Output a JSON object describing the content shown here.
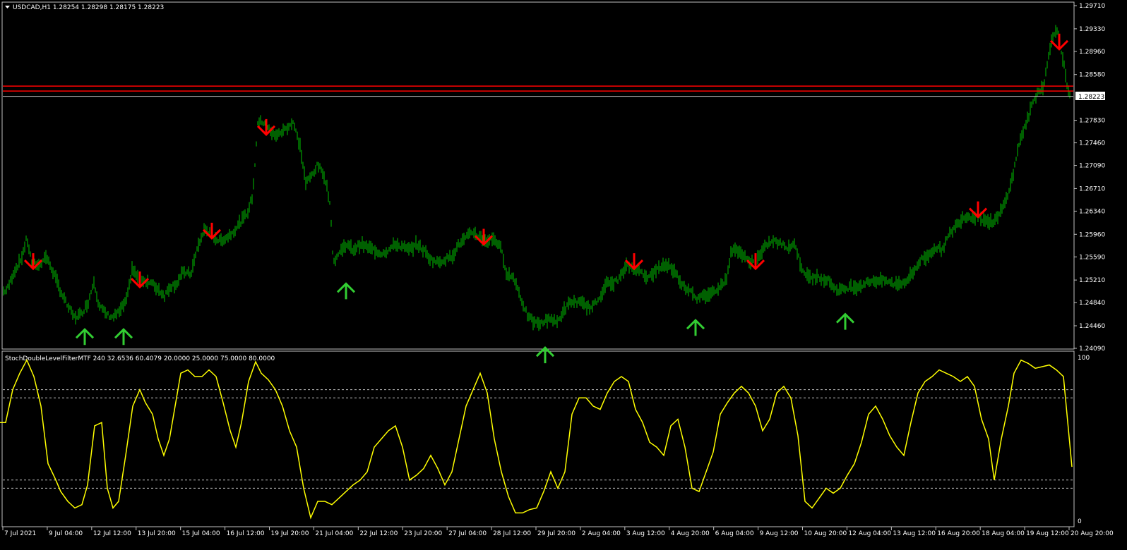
{
  "header": {
    "symbol_line": "USDCAD,H1  1.28254 1.28298 1.28175 1.28223"
  },
  "indicator": {
    "title_line": "StochDoubleLevelFilterMTF 240 32.6536 60.4079 20.0000 25.0000 75.0000 80.0000",
    "levels": [
      20,
      25,
      75,
      80
    ],
    "axis_labels": [
      "100",
      "0"
    ],
    "line_color": "#ffff00"
  },
  "price_axis": {
    "labels": [
      "1.29710",
      "1.29330",
      "1.28960",
      "1.28580",
      "1.28223",
      "1.27830",
      "1.27460",
      "1.27090",
      "1.26710",
      "1.26340",
      "1.25960",
      "1.25590",
      "1.25210",
      "1.24840",
      "1.24460",
      "1.24090"
    ],
    "current_price": "1.28223"
  },
  "time_axis": {
    "labels": [
      "7 Jul 2021",
      "9 Jul 04:00",
      "12 Jul 12:00",
      "13 Jul 20:00",
      "15 Jul 04:00",
      "16 Jul 12:00",
      "19 Jul 20:00",
      "21 Jul 04:00",
      "22 Jul 12:00",
      "23 Jul 20:00",
      "27 Jul 04:00",
      "28 Jul 12:00",
      "29 Jul 20:00",
      "2 Aug 04:00",
      "3 Aug 12:00",
      "4 Aug 20:00",
      "6 Aug 04:00",
      "9 Aug 12:00",
      "10 Aug 20:00",
      "12 Aug 04:00",
      "13 Aug 12:00",
      "16 Aug 20:00",
      "18 Aug 04:00",
      "19 Aug 12:00",
      "20 Aug 20:00"
    ]
  },
  "colors": {
    "bars": "#00c000",
    "up_arrow": "#32cd32",
    "down_arrow": "#ff0000",
    "hline": "#ff0000",
    "frame": "#c0c0c0"
  },
  "chart_data": {
    "type": "line",
    "price_path": [
      [
        0,
        1.25
      ],
      [
        10,
        1.2505
      ],
      [
        20,
        1.2535
      ],
      [
        30,
        1.2555
      ],
      [
        38,
        1.259
      ],
      [
        45,
        1.255
      ],
      [
        55,
        1.2545
      ],
      [
        65,
        1.256
      ],
      [
        75,
        1.2535
      ],
      [
        85,
        1.2505
      ],
      [
        95,
        1.248
      ],
      [
        105,
        1.246
      ],
      [
        115,
        1.2465
      ],
      [
        125,
        1.2485
      ],
      [
        133,
        1.252
      ],
      [
        140,
        1.248
      ],
      [
        150,
        1.2465
      ],
      [
        160,
        1.246
      ],
      [
        170,
        1.247
      ],
      [
        180,
        1.249
      ],
      [
        187,
        1.254
      ],
      [
        195,
        1.2525
      ],
      [
        205,
        1.252
      ],
      [
        215,
        1.2515
      ],
      [
        225,
        1.2505
      ],
      [
        233,
        1.2495
      ],
      [
        240,
        1.251
      ],
      [
        250,
        1.2515
      ],
      [
        260,
        1.2535
      ],
      [
        270,
        1.253
      ],
      [
        280,
        1.2575
      ],
      [
        290,
        1.2605
      ],
      [
        300,
        1.2595
      ],
      [
        310,
        1.2585
      ],
      [
        320,
        1.259
      ],
      [
        330,
        1.26
      ],
      [
        340,
        1.2615
      ],
      [
        350,
        1.263
      ],
      [
        358,
        1.266
      ],
      [
        365,
        1.278
      ],
      [
        375,
        1.278
      ],
      [
        385,
        1.276
      ],
      [
        395,
        1.276
      ],
      [
        405,
        1.277
      ],
      [
        415,
        1.278
      ],
      [
        425,
        1.274
      ],
      [
        433,
        1.268
      ],
      [
        440,
        1.269
      ],
      [
        450,
        1.271
      ],
      [
        460,
        1.269
      ],
      [
        467,
        1.265
      ],
      [
        472,
        1.255
      ],
      [
        480,
        1.2565
      ],
      [
        490,
        1.258
      ],
      [
        500,
        1.257
      ],
      [
        510,
        1.258
      ],
      [
        520,
        1.2575
      ],
      [
        530,
        1.257
      ],
      [
        540,
        1.2565
      ],
      [
        550,
        1.257
      ],
      [
        560,
        1.258
      ],
      [
        570,
        1.2575
      ],
      [
        580,
        1.257
      ],
      [
        590,
        1.258
      ],
      [
        600,
        1.257
      ],
      [
        610,
        1.2555
      ],
      [
        620,
        1.255
      ],
      [
        630,
        1.2555
      ],
      [
        640,
        1.256
      ],
      [
        650,
        1.258
      ],
      [
        660,
        1.259
      ],
      [
        670,
        1.26
      ],
      [
        680,
        1.259
      ],
      [
        690,
        1.2585
      ],
      [
        700,
        1.259
      ],
      [
        710,
        1.257
      ],
      [
        718,
        1.253
      ],
      [
        728,
        1.2525
      ],
      [
        738,
        1.249
      ],
      [
        748,
        1.246
      ],
      [
        758,
        1.245
      ],
      [
        768,
        1.245
      ],
      [
        778,
        1.246
      ],
      [
        788,
        1.245
      ],
      [
        798,
        1.247
      ],
      [
        808,
        1.2485
      ],
      [
        818,
        1.2485
      ],
      [
        828,
        1.248
      ],
      [
        838,
        1.2475
      ],
      [
        848,
        1.249
      ],
      [
        858,
        1.2515
      ],
      [
        868,
        1.2515
      ],
      [
        878,
        1.2525
      ],
      [
        888,
        1.2545
      ],
      [
        898,
        1.254
      ],
      [
        908,
        1.2535
      ],
      [
        918,
        1.2525
      ],
      [
        928,
        1.2535
      ],
      [
        938,
        1.2545
      ],
      [
        948,
        1.2545
      ],
      [
        958,
        1.253
      ],
      [
        968,
        1.251
      ],
      [
        978,
        1.2505
      ],
      [
        988,
        1.249
      ],
      [
        998,
        1.2495
      ],
      [
        1008,
        1.25
      ],
      [
        1018,
        1.251
      ],
      [
        1028,
        1.252
      ],
      [
        1036,
        1.257
      ],
      [
        1046,
        1.257
      ],
      [
        1056,
        1.2555
      ],
      [
        1066,
        1.255
      ],
      [
        1076,
        1.256
      ],
      [
        1086,
        1.258
      ],
      [
        1096,
        1.2585
      ],
      [
        1106,
        1.258
      ],
      [
        1116,
        1.2575
      ],
      [
        1126,
        1.258
      ],
      [
        1134,
        1.2545
      ],
      [
        1144,
        1.2525
      ],
      [
        1154,
        1.2525
      ],
      [
        1164,
        1.2525
      ],
      [
        1174,
        1.252
      ],
      [
        1184,
        1.2505
      ],
      [
        1194,
        1.2505
      ],
      [
        1204,
        1.251
      ],
      [
        1214,
        1.251
      ],
      [
        1224,
        1.2515
      ],
      [
        1234,
        1.252
      ],
      [
        1244,
        1.252
      ],
      [
        1254,
        1.252
      ],
      [
        1264,
        1.2515
      ],
      [
        1274,
        1.2515
      ],
      [
        1284,
        1.252
      ],
      [
        1294,
        1.2535
      ],
      [
        1304,
        1.2555
      ],
      [
        1314,
        1.256
      ],
      [
        1324,
        1.2575
      ],
      [
        1334,
        1.257
      ],
      [
        1344,
        1.2595
      ],
      [
        1354,
        1.261
      ],
      [
        1364,
        1.2625
      ],
      [
        1374,
        1.2625
      ],
      [
        1384,
        1.2625
      ],
      [
        1394,
        1.262
      ],
      [
        1404,
        1.2615
      ],
      [
        1414,
        1.2625
      ],
      [
        1424,
        1.265
      ],
      [
        1434,
        1.269
      ],
      [
        1444,
        1.275
      ],
      [
        1454,
        1.278
      ],
      [
        1462,
        1.281
      ],
      [
        1470,
        1.283
      ],
      [
        1478,
        1.284
      ],
      [
        1484,
        1.288
      ],
      [
        1490,
        1.292
      ],
      [
        1496,
        1.2935
      ],
      [
        1502,
        1.29
      ],
      [
        1508,
        1.287
      ],
      [
        1512,
        1.283
      ],
      [
        1516,
        1.282
      ]
    ],
    "up_arrows": [
      [
        120,
        1.244
      ],
      [
        175,
        1.244
      ],
      [
        490,
        1.2515
      ],
      [
        772,
        1.241
      ],
      [
        985,
        1.2455
      ],
      [
        1197,
        1.2465
      ]
    ],
    "down_arrows": [
      [
        47,
        1.2565
      ],
      [
        198,
        1.2535
      ],
      [
        300,
        1.2615
      ],
      [
        377,
        1.2785
      ],
      [
        685,
        1.2605
      ],
      [
        898,
        1.2565
      ],
      [
        1070,
        1.2565
      ],
      [
        1385,
        1.265
      ],
      [
        1500,
        1.2925
      ]
    ],
    "hlines": [
      1.2839,
      1.2831
    ],
    "stoch_path": [
      [
        0,
        60
      ],
      [
        8,
        60
      ],
      [
        18,
        80
      ],
      [
        28,
        90
      ],
      [
        38,
        98
      ],
      [
        48,
        88
      ],
      [
        58,
        70
      ],
      [
        68,
        35
      ],
      [
        78,
        26
      ],
      [
        86,
        18
      ],
      [
        96,
        12
      ],
      [
        106,
        8
      ],
      [
        116,
        10
      ],
      [
        124,
        22
      ],
      [
        134,
        58
      ],
      [
        144,
        60
      ],
      [
        152,
        20
      ],
      [
        160,
        8
      ],
      [
        168,
        12
      ],
      [
        178,
        40
      ],
      [
        188,
        70
      ],
      [
        198,
        80
      ],
      [
        206,
        72
      ],
      [
        216,
        65
      ],
      [
        224,
        50
      ],
      [
        232,
        40
      ],
      [
        240,
        50
      ],
      [
        248,
        70
      ],
      [
        256,
        90
      ],
      [
        266,
        92
      ],
      [
        276,
        88
      ],
      [
        286,
        88
      ],
      [
        296,
        92
      ],
      [
        306,
        88
      ],
      [
        316,
        72
      ],
      [
        326,
        55
      ],
      [
        334,
        45
      ],
      [
        342,
        60
      ],
      [
        352,
        85
      ],
      [
        362,
        97
      ],
      [
        370,
        90
      ],
      [
        380,
        86
      ],
      [
        390,
        80
      ],
      [
        400,
        70
      ],
      [
        410,
        55
      ],
      [
        420,
        45
      ],
      [
        430,
        20
      ],
      [
        440,
        2
      ],
      [
        450,
        12
      ],
      [
        460,
        12
      ],
      [
        470,
        10
      ],
      [
        480,
        14
      ],
      [
        490,
        18
      ],
      [
        500,
        22
      ],
      [
        510,
        25
      ],
      [
        520,
        30
      ],
      [
        530,
        45
      ],
      [
        540,
        50
      ],
      [
        550,
        55
      ],
      [
        560,
        58
      ],
      [
        570,
        45
      ],
      [
        580,
        25
      ],
      [
        590,
        28
      ],
      [
        600,
        32
      ],
      [
        610,
        40
      ],
      [
        620,
        32
      ],
      [
        630,
        22
      ],
      [
        640,
        30
      ],
      [
        650,
        50
      ],
      [
        660,
        70
      ],
      [
        670,
        80
      ],
      [
        680,
        90
      ],
      [
        690,
        78
      ],
      [
        700,
        50
      ],
      [
        710,
        30
      ],
      [
        720,
        15
      ],
      [
        730,
        5
      ],
      [
        740,
        5
      ],
      [
        750,
        7
      ],
      [
        760,
        8
      ],
      [
        770,
        18
      ],
      [
        780,
        30
      ],
      [
        790,
        20
      ],
      [
        800,
        30
      ],
      [
        810,
        65
      ],
      [
        820,
        75
      ],
      [
        830,
        75
      ],
      [
        840,
        70
      ],
      [
        850,
        68
      ],
      [
        860,
        78
      ],
      [
        870,
        85
      ],
      [
        880,
        88
      ],
      [
        890,
        85
      ],
      [
        900,
        68
      ],
      [
        910,
        60
      ],
      [
        920,
        48
      ],
      [
        930,
        45
      ],
      [
        940,
        40
      ],
      [
        950,
        58
      ],
      [
        960,
        62
      ],
      [
        970,
        45
      ],
      [
        980,
        20
      ],
      [
        990,
        18
      ],
      [
        1000,
        30
      ],
      [
        1010,
        42
      ],
      [
        1020,
        65
      ],
      [
        1030,
        72
      ],
      [
        1040,
        78
      ],
      [
        1050,
        82
      ],
      [
        1060,
        78
      ],
      [
        1070,
        70
      ],
      [
        1080,
        55
      ],
      [
        1090,
        62
      ],
      [
        1100,
        78
      ],
      [
        1110,
        82
      ],
      [
        1120,
        75
      ],
      [
        1130,
        52
      ],
      [
        1140,
        12
      ],
      [
        1150,
        8
      ],
      [
        1160,
        14
      ],
      [
        1170,
        20
      ],
      [
        1180,
        17
      ],
      [
        1190,
        20
      ],
      [
        1200,
        28
      ],
      [
        1210,
        35
      ],
      [
        1220,
        48
      ],
      [
        1230,
        65
      ],
      [
        1240,
        70
      ],
      [
        1250,
        62
      ],
      [
        1260,
        52
      ],
      [
        1270,
        45
      ],
      [
        1280,
        40
      ],
      [
        1290,
        60
      ],
      [
        1300,
        78
      ],
      [
        1310,
        85
      ],
      [
        1320,
        88
      ],
      [
        1330,
        92
      ],
      [
        1340,
        90
      ],
      [
        1350,
        88
      ],
      [
        1360,
        85
      ],
      [
        1370,
        88
      ],
      [
        1380,
        82
      ],
      [
        1390,
        62
      ],
      [
        1400,
        50
      ],
      [
        1408,
        25
      ],
      [
        1418,
        50
      ],
      [
        1428,
        70
      ],
      [
        1436,
        90
      ],
      [
        1446,
        98
      ],
      [
        1456,
        96
      ],
      [
        1466,
        93
      ],
      [
        1476,
        94
      ],
      [
        1486,
        95
      ],
      [
        1496,
        92
      ],
      [
        1506,
        88
      ],
      [
        1518,
        33
      ]
    ]
  }
}
